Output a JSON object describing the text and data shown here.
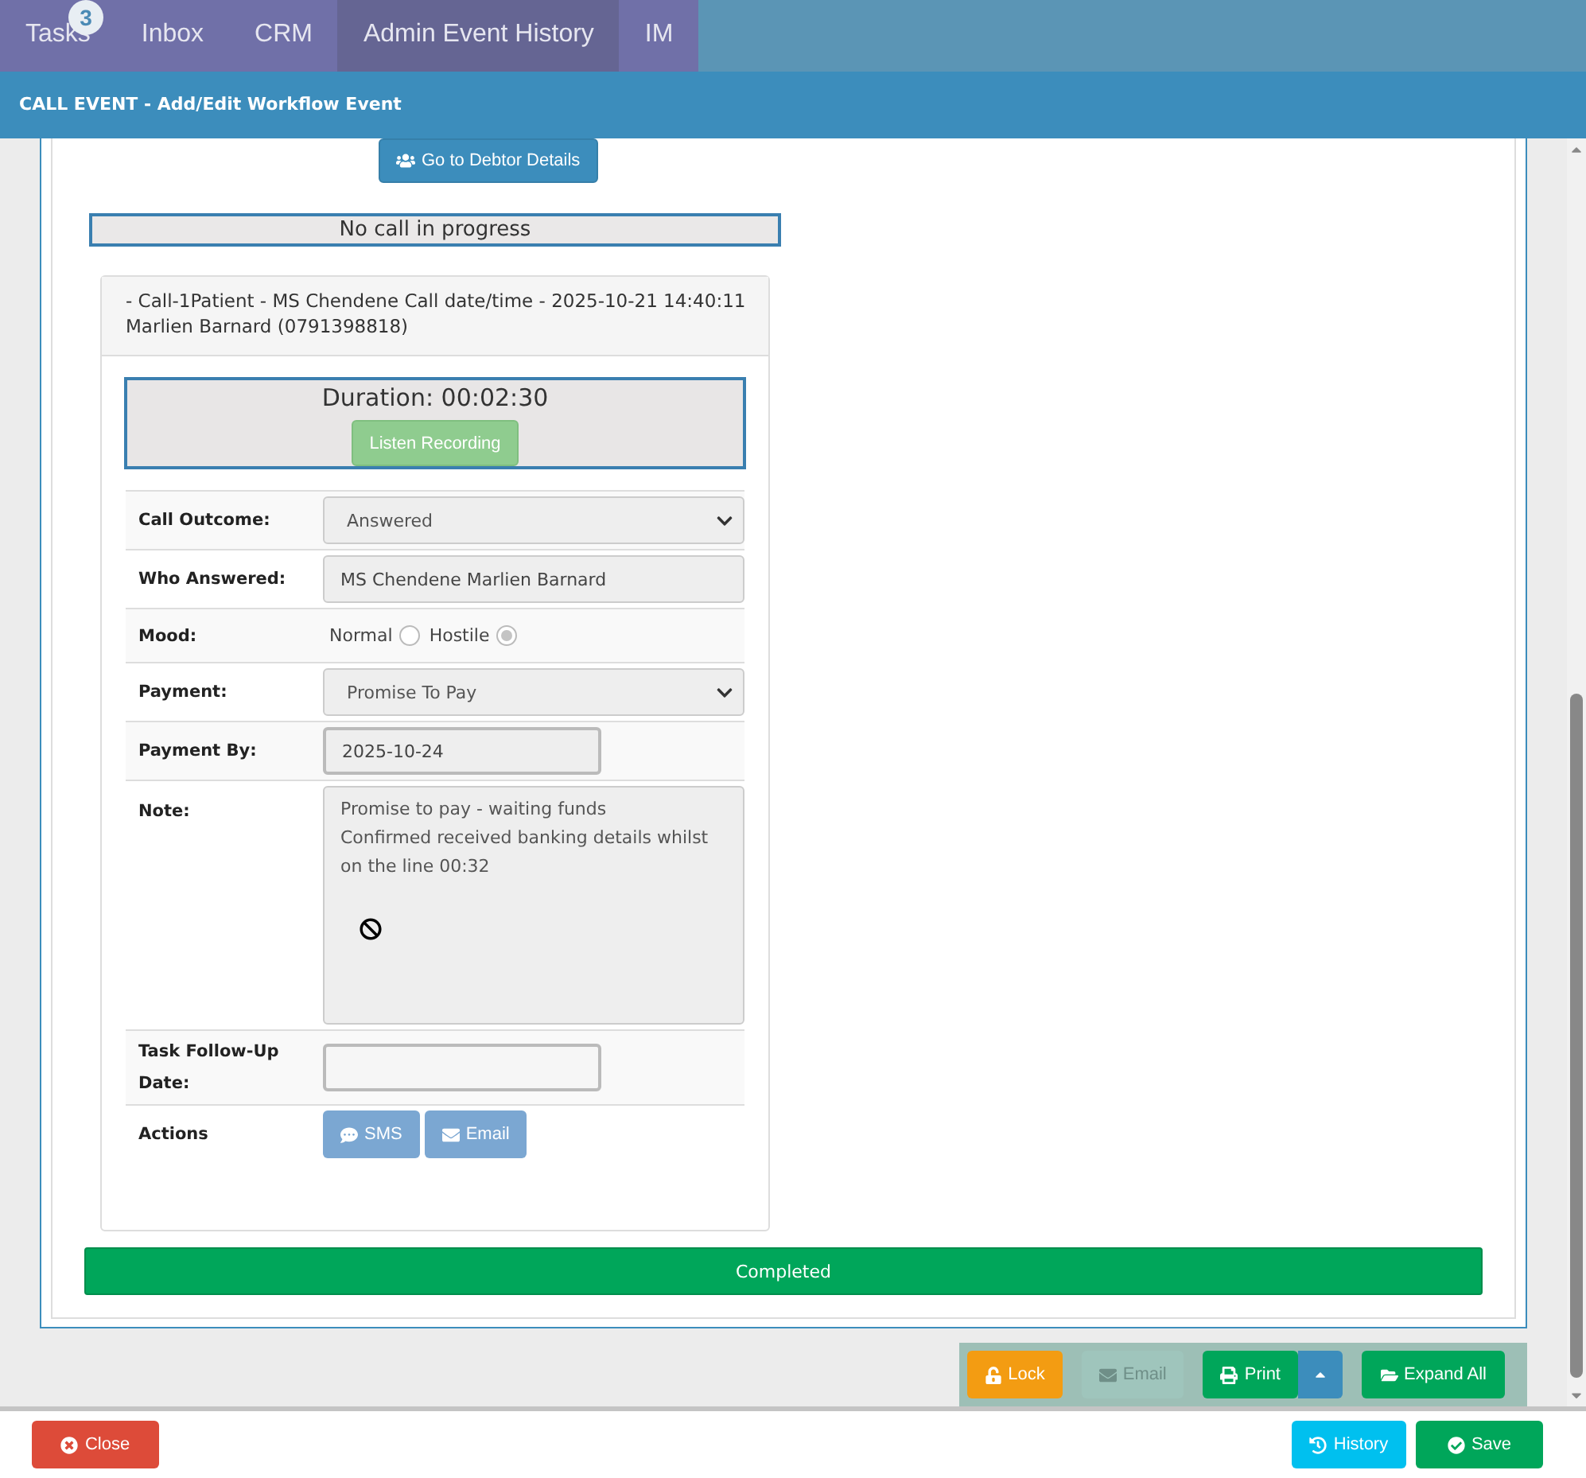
{
  "nav": {
    "tabs": [
      {
        "label": "Tasks",
        "selected": false,
        "badge": "3"
      },
      {
        "label": "Inbox",
        "selected": false
      },
      {
        "label": "CRM",
        "selected": false
      },
      {
        "label": "Admin Event History",
        "selected": true
      },
      {
        "label": "IM",
        "selected": false
      }
    ]
  },
  "header": {
    "title": "CALL EVENT - Add/Edit Workflow Event"
  },
  "debtor_button": "Go to Debtor Details",
  "call_status": "No call in progress",
  "call": {
    "heading": [
      "- Call-1Patient - MS Chendene  Call date/time - 2025-10-21 14:40:11",
      "Marlien Barnard (0791398818)"
    ],
    "duration": "Duration: 00:02:30",
    "listen_button": "Listen Recording",
    "fields": [
      {
        "kind": "select",
        "label": "Call Outcome:",
        "value": "Answered"
      },
      {
        "kind": "text",
        "label": "Who Answered:",
        "value": "MS Chendene Marlien Barnard"
      },
      {
        "kind": "radio",
        "label": "Mood:",
        "options": [
          {
            "label": "Normal",
            "selected": false
          },
          {
            "label": "Hostile",
            "selected": true
          }
        ]
      },
      {
        "kind": "select",
        "label": "Payment:",
        "value": "Promise To Pay"
      },
      {
        "kind": "date",
        "label": "Payment By:",
        "value": "2025-10-24"
      },
      {
        "kind": "textarea",
        "label": "Note:",
        "value": "Promise to pay - waiting funds\nConfirmed received banking details whilst on the line 00:32"
      },
      {
        "kind": "date",
        "label": "Task Follow-Up Date:"
      },
      {
        "kind": "buttons",
        "label": "Actions",
        "buttons": [
          {
            "kind": "sms",
            "label": "SMS"
          },
          {
            "kind": "email",
            "label": "Email"
          }
        ]
      }
    ]
  },
  "status_bar": "Completed",
  "toolbar": [
    {
      "kind": "lock",
      "label": "Lock",
      "disabled": false
    },
    {
      "kind": "email",
      "label": "Email",
      "disabled": true
    },
    {
      "kind": "print",
      "label": "Print",
      "disabled": false
    },
    {
      "kind": "expand",
      "label": "Expand All",
      "disabled": false
    }
  ],
  "footer": [
    {
      "kind": "close",
      "label": "Close"
    },
    {
      "kind": "history",
      "label": "History"
    },
    {
      "kind": "save",
      "label": "Save"
    }
  ]
}
